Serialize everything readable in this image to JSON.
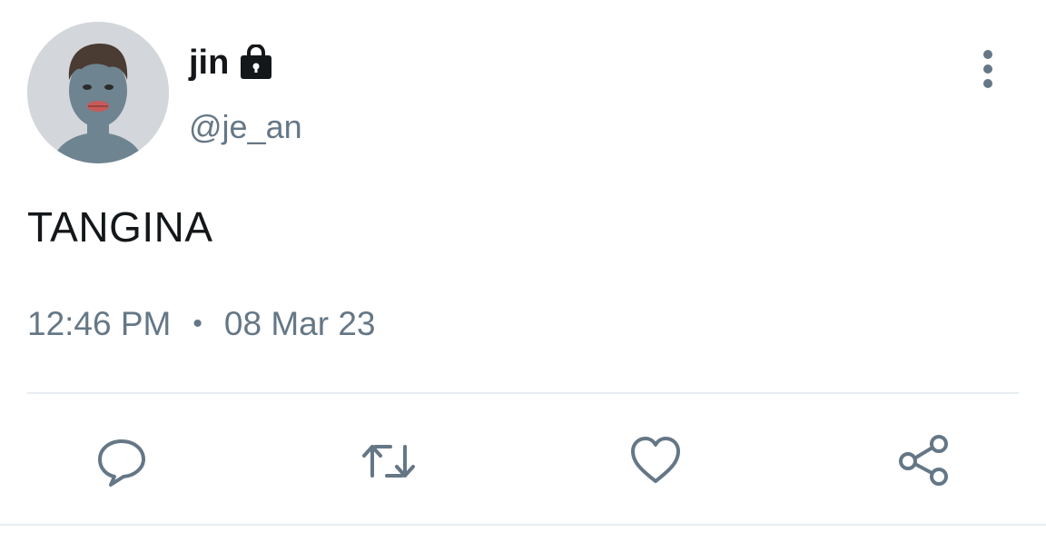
{
  "user": {
    "display_name": "jin",
    "handle": "@je_an",
    "protected": true,
    "avatar_icon": "user-avatar-photo"
  },
  "tweet": {
    "text": "TANGINA",
    "time": "12:46 PM",
    "separator": "•",
    "date": "08 Mar 23"
  },
  "actions": {
    "reply_icon": "reply-icon",
    "retweet_icon": "retweet-icon",
    "like_icon": "heart-icon",
    "share_icon": "share-icon",
    "more_icon": "more-vertical-icon"
  },
  "colors": {
    "text": "#14171a",
    "secondary": "#657786",
    "divider": "#e6ecf0",
    "avatar_bg": "#d3d6da",
    "avatar_body": "#6e8490"
  }
}
